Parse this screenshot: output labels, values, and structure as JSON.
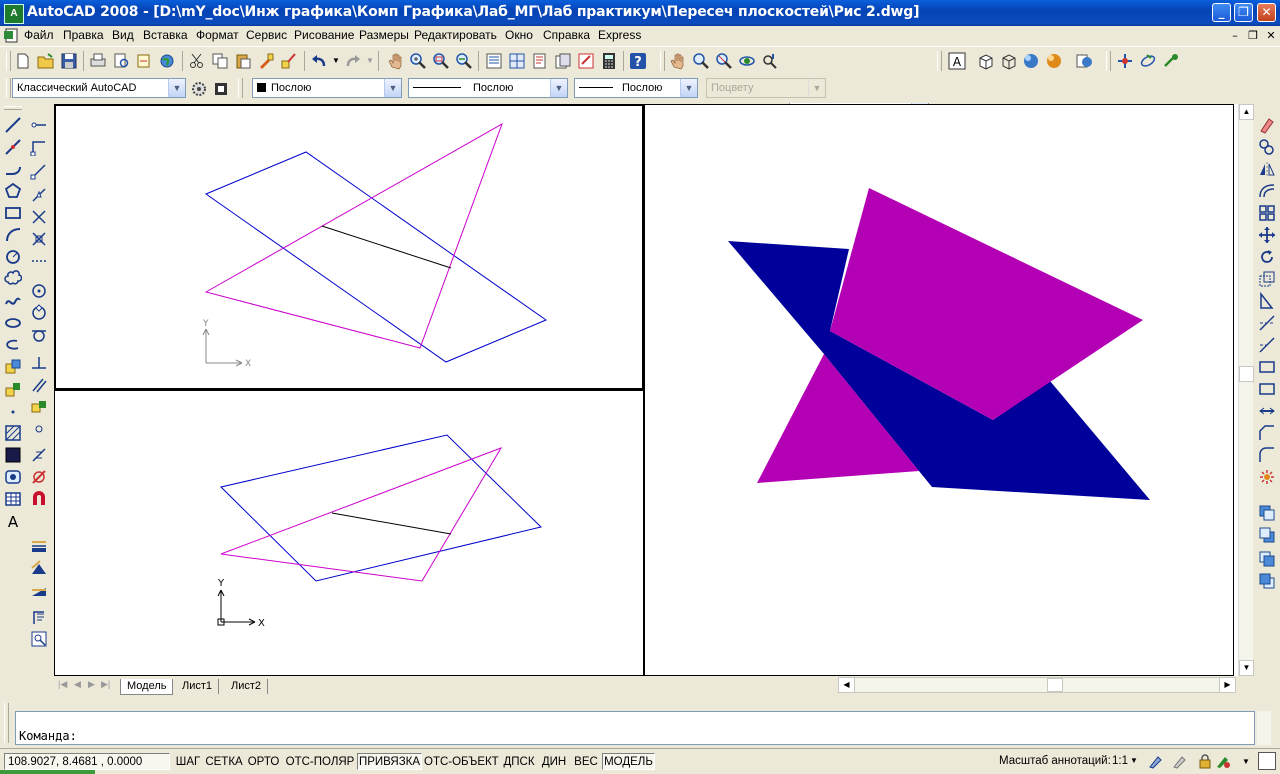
{
  "window": {
    "title": "AutoCAD 2008 - [D:\\mY_doc\\Инж графика\\Комп Графика\\Лаб_МГ\\Лаб практикум\\Пересеч плоскостей\\Рис 2.dwg]",
    "logo": "A"
  },
  "menu": {
    "items": [
      "Файл",
      "Правка",
      "Вид",
      "Вставка",
      "Формат",
      "Сервис",
      "Рисование",
      "Размеры",
      "Редактировать",
      "Окно",
      "Справка",
      "Express"
    ]
  },
  "toolbar2": {
    "workspace": "Классический AutoCAD",
    "layer_color": "Послою",
    "linetype": "Послою",
    "lineweight": "Послою",
    "plotstyle": "Поцвету"
  },
  "colors": {
    "blue": "#0000cc",
    "magenta": "#cc00cc",
    "fill_blue": "#00009a",
    "fill_magenta": "#b400b4"
  },
  "axes": {
    "x": "X",
    "y": "Y"
  },
  "tabs": [
    "Модель",
    "Лист1",
    "Лист2"
  ],
  "command": {
    "prompt": "Команда:"
  },
  "status": {
    "coords": "108.9027, 8.4681 , 0.0000",
    "buttons": [
      "ШАГ",
      "СЕТКА",
      "ОРТО",
      "ОТС-ПОЛЯР",
      "ПРИВЯЗКА",
      "ОТС-ОБЪЕКТ",
      "ДПСК",
      "ДИН",
      "ВЕС",
      "МОДЕЛЬ"
    ],
    "scale_label": "Масштаб аннотаций:",
    "scale_value": "1:1"
  }
}
